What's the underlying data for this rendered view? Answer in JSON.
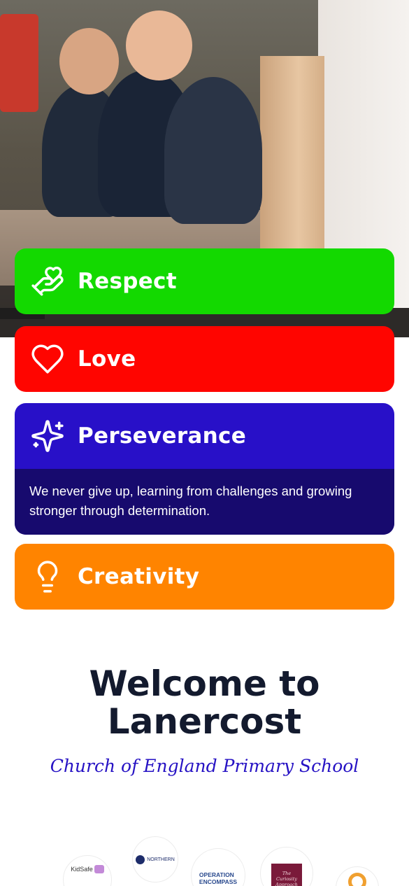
{
  "values": [
    {
      "title": "Respect",
      "icon": "heart-hand-icon",
      "color": "#13d900"
    },
    {
      "title": "Love",
      "icon": "heart-icon",
      "color": "#ff0500"
    },
    {
      "title": "Perseverance",
      "icon": "sparkles-icon",
      "color": "#2810c8",
      "description": "We never give up, learning from challenges and growing stronger through determination."
    },
    {
      "title": "Creativity",
      "icon": "lightbulb-icon",
      "color": "#ff8400"
    }
  ],
  "welcome": {
    "line1": "Welcome to",
    "line2": "Lanercost",
    "subtitle": "Church of England Primary School"
  },
  "partners": [
    {
      "name": "KidSafe",
      "text": "KidSafe"
    },
    {
      "name": "Northern",
      "text": "NORTHERN"
    },
    {
      "name": "Operation Encompass",
      "text1": "OPERATION",
      "text2": "ENCOMPASS"
    },
    {
      "name": "The Curiosity Approach",
      "text": "The Curiosity Approach"
    },
    {
      "name": "Partner Badge",
      "text": ""
    }
  ]
}
